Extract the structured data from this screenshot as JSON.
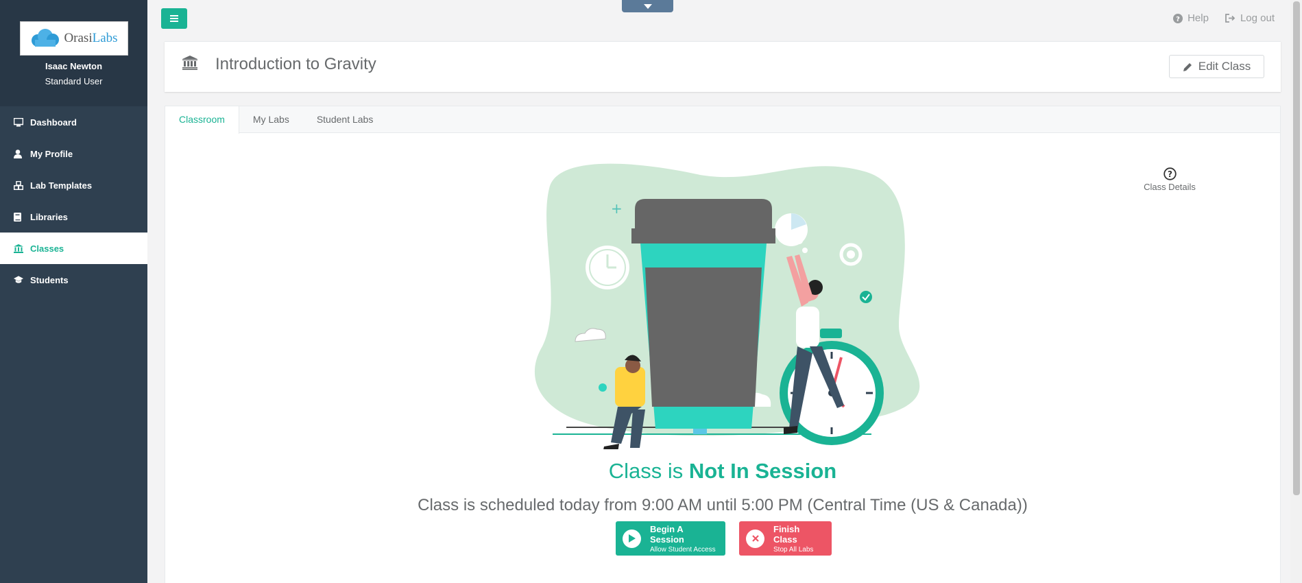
{
  "sidebar": {
    "logo": {
      "orasi": "Orasi",
      "labs": "Labs"
    },
    "user_name": "Isaac Newton",
    "user_role": "Standard User",
    "items": [
      {
        "label": "Dashboard",
        "icon": "monitor-icon"
      },
      {
        "label": "My Profile",
        "icon": "user-icon"
      },
      {
        "label": "Lab Templates",
        "icon": "cubes-icon"
      },
      {
        "label": "Libraries",
        "icon": "book-icon"
      },
      {
        "label": "Classes",
        "icon": "bank-icon",
        "active": true
      },
      {
        "label": "Students",
        "icon": "graduation-cap-icon"
      }
    ]
  },
  "topbar": {
    "help": "Help",
    "logout": "Log out"
  },
  "header": {
    "title": "Introduction to Gravity",
    "edit_label": "Edit Class"
  },
  "tabs": [
    "Classroom",
    "My Labs",
    "Student Labs"
  ],
  "details_label": "Class Details",
  "status": {
    "prefix": "Class is ",
    "state": "Not In Session"
  },
  "schedule": "Class is scheduled today from 9:00 AM until 5:00 PM (Central Time (US & Canada))",
  "actions": {
    "begin_title": "Begin A Session",
    "begin_sub": "Allow Student Access",
    "finish_title": "Finish Class",
    "finish_sub": "Stop All Labs"
  },
  "colors": {
    "accent": "#1ab394",
    "danger": "#ed5565",
    "sidebar": "#2f4050"
  }
}
